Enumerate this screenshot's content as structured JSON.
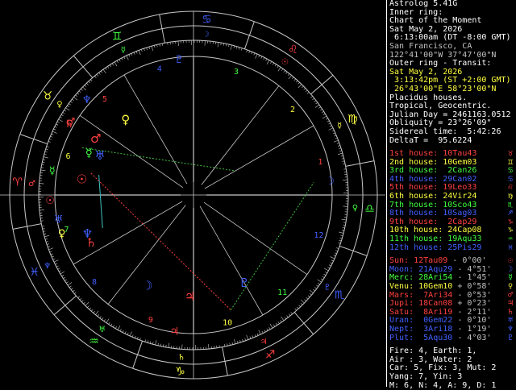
{
  "header": {
    "program": "Astrolog 5.41G",
    "inner_ring": "Inner ring:",
    "chart_name": "Chart of the Moment",
    "date": "Sat May 2, 2026",
    "time": " 6:13:00am (DT -8:00 GMT)",
    "location": "San Francisco, CA",
    "coords": "122°41'00\"W 37°47'00\"N",
    "outer_ring": "Outer ring - Transit:",
    "transit_date": "Sat May 2, 2026",
    "transit_time": " 3:13:42pm (ST +2:00 GMT)",
    "transit_coords": " 26°43'00\"E 58°23'00\"N",
    "house_system": "Placidus houses.",
    "zodiac": "Tropical, Geocentric.",
    "julian": "Julian Day = 2461163.0512",
    "obliquity": "Obliquity = 23°26'09\"",
    "sidereal": "Sidereal time:  5:42:26",
    "deltat": "DeltaT =  95.6224"
  },
  "houses": [
    {
      "label": "1st house:",
      "value": "10Tau43",
      "color": "#ff4040",
      "symbol": "♉"
    },
    {
      "label": "2nd house:",
      "value": "10Gem03",
      "color": "#ffff40",
      "symbol": "♊"
    },
    {
      "label": "3rd house:",
      "value": " 2Can26",
      "color": "#40ff40",
      "symbol": "♋"
    },
    {
      "label": "4th house:",
      "value": "29Can02",
      "color": "#4060ff",
      "symbol": "♋"
    },
    {
      "label": "5th house:",
      "value": "19Leo33",
      "color": "#ff4040",
      "symbol": "♌"
    },
    {
      "label": "6th house:",
      "value": "24Vir24",
      "color": "#ffff40",
      "symbol": "♍"
    },
    {
      "label": "7th house:",
      "value": "10Sco43",
      "color": "#40ff40",
      "symbol": "♏"
    },
    {
      "label": "8th house:",
      "value": "10Sag03",
      "color": "#4060ff",
      "symbol": "♐"
    },
    {
      "label": "9th house:",
      "value": " 2Cap29",
      "color": "#ff4040",
      "symbol": "♑"
    },
    {
      "label": "10th house:",
      "value": "24Cap08",
      "color": "#ffff40",
      "symbol": "♑"
    },
    {
      "label": "11th house:",
      "value": "19Aqu33",
      "color": "#40ff40",
      "symbol": "♒"
    },
    {
      "label": "12th house:",
      "value": "25Pis29",
      "color": "#4060ff",
      "symbol": "♓"
    }
  ],
  "planets": [
    {
      "label": "Sun:",
      "value": "12Tau09",
      "motion": " - 0°00'",
      "color": "#ff4040",
      "symbol": "☉"
    },
    {
      "label": "Moon:",
      "value": "21Aqu29",
      "motion": " - 4°51'",
      "color": "#4060ff",
      "symbol": "☽"
    },
    {
      "label": "Merc:",
      "value": "28Ari54",
      "motion": " - 1°45'",
      "color": "#40ff40",
      "symbol": "☿"
    },
    {
      "label": "Venu:",
      "value": "10Gem10",
      "motion": " + 0°58'",
      "color": "#ffff40",
      "symbol": "♀"
    },
    {
      "label": "Mars:",
      "value": " 7Ari34",
      "motion": " - 0°53'",
      "color": "#ff4040",
      "symbol": "♂"
    },
    {
      "label": "Jupi:",
      "value": "18Can08",
      "motion": " + 0°23'",
      "color": "#ff4040",
      "symbol": "♃"
    },
    {
      "label": "Satu:",
      "value": " 8Ari19",
      "motion": " - 2°11'",
      "color": "#ff4040",
      "symbol": "♄"
    },
    {
      "label": "Uran:",
      "value": " 0Gem22",
      "motion": " - 0°10'",
      "color": "#4060ff",
      "symbol": "♅"
    },
    {
      "label": "Nept:",
      "value": " 3Ari18",
      "motion": " - 1°19'",
      "color": "#4060ff",
      "symbol": "♆"
    },
    {
      "label": "Plut:",
      "value": " 5Aqu30",
      "motion": " - 4°03'",
      "color": "#4060ff",
      "symbol": "♇"
    }
  ],
  "elements": {
    "line1": "Fire: 4, Earth: 1,",
    "line2": "Air : 3, Water: 2",
    "line3": "Car: 5, Fix: 3, Mut: 2",
    "line4": "Yang: 7, Yin: 3",
    "line5": "M: 6, N: 4, A: 9, D: 1"
  },
  "wheel": {
    "house_numbers": [
      "1",
      "2",
      "3",
      "4",
      "5",
      "6",
      "7",
      "8",
      "9",
      "10",
      "11",
      "12"
    ],
    "signs": [
      "♈",
      "♉",
      "♊",
      "♋",
      "♌",
      "♍",
      "♎",
      "♏",
      "♐",
      "♑",
      "♒",
      "♓"
    ],
    "sign_colors": [
      "#ff4040",
      "#ffff40",
      "#40ff40",
      "#4060ff",
      "#ff4040",
      "#ffff40",
      "#40ff40",
      "#4060ff",
      "#ff4040",
      "#ffff40",
      "#40ff40",
      "#4060ff"
    ],
    "ruler_glyphs": [
      "♂",
      "♀",
      "☿",
      "☽",
      "☉",
      "☿",
      "♀",
      "♇",
      "♃",
      "♄",
      "♅",
      "♆"
    ],
    "inner_planets": [
      {
        "glyph": "☉",
        "color": "#ff4040"
      },
      {
        "glyph": "☽",
        "color": "#4060ff"
      },
      {
        "glyph": "☿",
        "color": "#40ff40"
      },
      {
        "glyph": "♀",
        "color": "#ffff40"
      },
      {
        "glyph": "♂",
        "color": "#ff4040"
      },
      {
        "glyph": "♃",
        "color": "#ff4040"
      },
      {
        "glyph": "♄",
        "color": "#ff4040"
      },
      {
        "glyph": "♅",
        "color": "#4060ff"
      },
      {
        "glyph": "♆",
        "color": "#4060ff"
      },
      {
        "glyph": "♇",
        "color": "#4060ff"
      }
    ],
    "outer_planets": [
      {
        "glyph": "☉",
        "color": "#ff4040"
      },
      {
        "glyph": "☽",
        "color": "#4060ff"
      },
      {
        "glyph": "☿",
        "color": "#40ff40"
      },
      {
        "glyph": "♀",
        "color": "#ffff40"
      },
      {
        "glyph": "♂",
        "color": "#ff4040"
      },
      {
        "glyph": "♃",
        "color": "#ff4040"
      },
      {
        "glyph": "♄",
        "color": "#ff4040"
      },
      {
        "glyph": "♅",
        "color": "#4060ff"
      },
      {
        "glyph": "♆",
        "color": "#4060ff"
      },
      {
        "glyph": "♇",
        "color": "#4060ff"
      }
    ]
  }
}
